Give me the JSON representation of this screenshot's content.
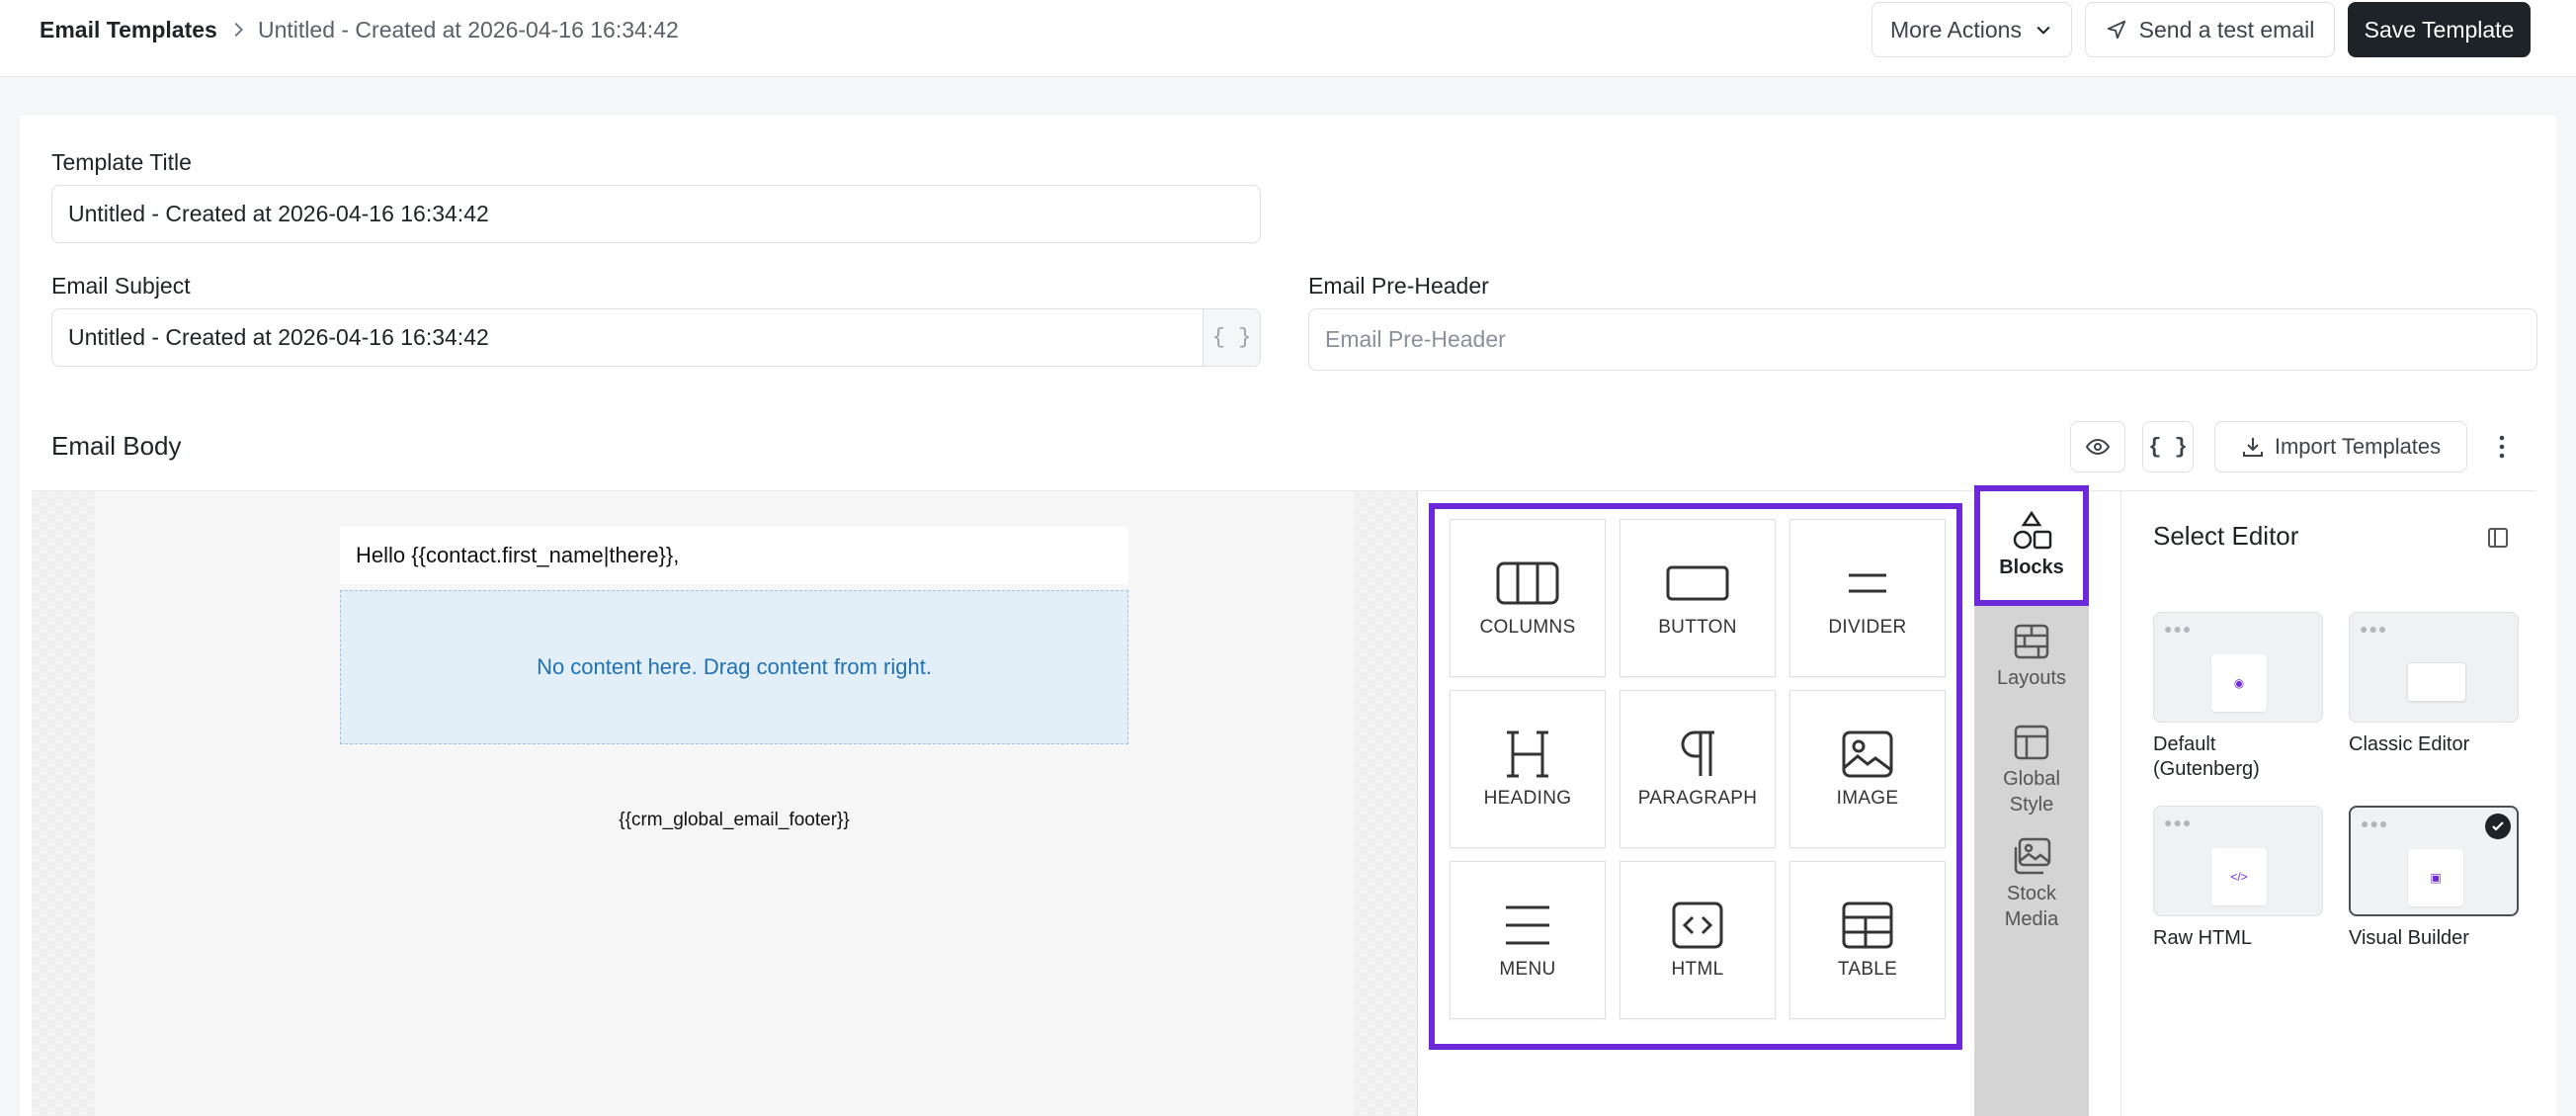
{
  "header": {
    "breadcrumb_root": "Email Templates",
    "breadcrumb_current": "Untitled - Created at 2026-04-16 16:34:42",
    "more_actions_label": "More Actions",
    "send_test_label": "Send a test email",
    "save_label": "Save Template"
  },
  "form": {
    "title_label": "Template Title",
    "title_value": "Untitled - Created at 2026-04-16 16:34:42",
    "subject_label": "Email Subject",
    "subject_value": "Untitled - Created at 2026-04-16 16:34:42",
    "subject_addon": "{ }",
    "preheader_label": "Email Pre-Header",
    "preheader_placeholder": "Email Pre-Header"
  },
  "email_body": {
    "title": "Email Body",
    "shortcode_label": "{ }",
    "import_label": "Import Templates"
  },
  "canvas": {
    "greeting": "Hello {{contact.first_name|there}},",
    "drop_hint": "No content here. Drag content from right.",
    "footer_shortcode": "{{crm_global_email_footer}}"
  },
  "blocks": [
    {
      "label": "COLUMNS",
      "icon": "columns-icon"
    },
    {
      "label": "BUTTON",
      "icon": "button-icon"
    },
    {
      "label": "DIVIDER",
      "icon": "divider-icon"
    },
    {
      "label": "HEADING",
      "icon": "heading-icon"
    },
    {
      "label": "PARAGRAPH",
      "icon": "paragraph-icon"
    },
    {
      "label": "IMAGE",
      "icon": "image-icon"
    },
    {
      "label": "MENU",
      "icon": "menu-icon"
    },
    {
      "label": "HTML",
      "icon": "html-icon"
    },
    {
      "label": "TABLE",
      "icon": "table-icon"
    }
  ],
  "side_tabs": {
    "blocks": "Blocks",
    "layouts": "Layouts",
    "global_style": "Global Style",
    "stock_media": "Stock Media"
  },
  "select_editor": {
    "title": "Select Editor",
    "options": [
      {
        "label": "Default (Gutenberg)",
        "selected": false
      },
      {
        "label": "Classic Editor",
        "selected": false
      },
      {
        "label": "Raw HTML",
        "selected": false
      },
      {
        "label": "Visual Builder",
        "selected": true
      }
    ]
  },
  "colors": {
    "highlight": "#6d28d9",
    "primary_dark": "#1d2327",
    "link_blue": "#2271b1"
  }
}
